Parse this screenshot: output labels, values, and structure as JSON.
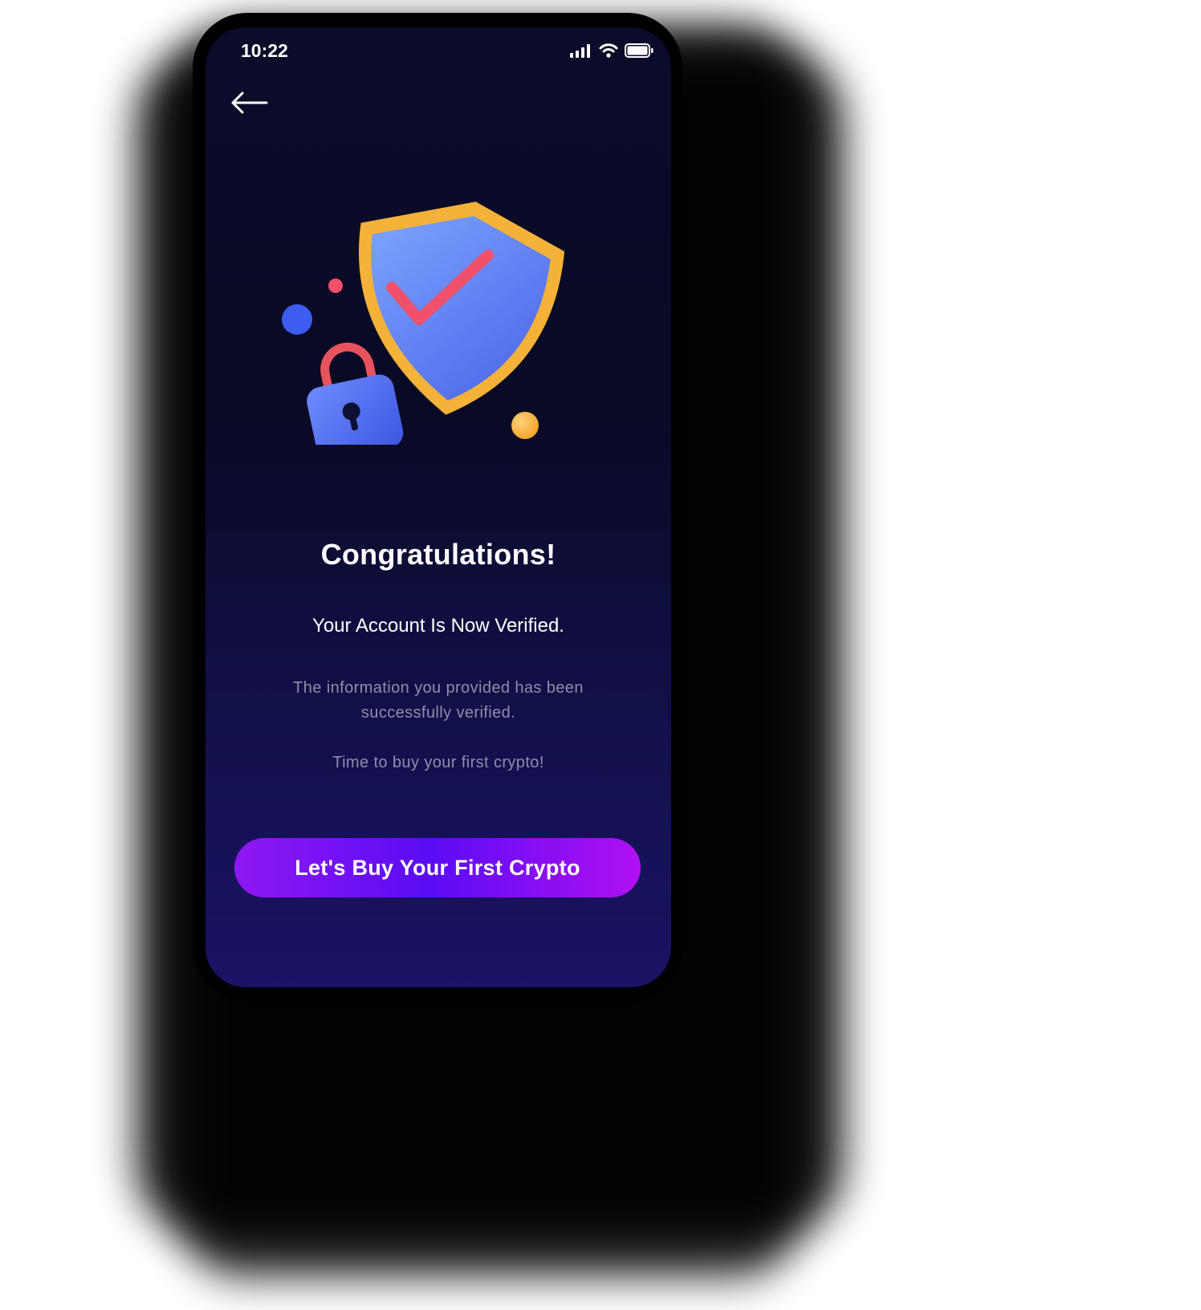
{
  "status_bar": {
    "time": "10:22",
    "icons": [
      "signal-icon",
      "wifi-icon",
      "battery-icon"
    ]
  },
  "nav": {
    "back_icon": "back-arrow-icon"
  },
  "illustration": {
    "icons": [
      "shield-check-icon",
      "padlock-icon"
    ],
    "colors": {
      "shield": "#6a8cf7",
      "shield_rim": "#f6b940",
      "check": "#f0506a",
      "lock": "#4f6ef0"
    }
  },
  "content": {
    "title": "Congratulations!",
    "subtitle": "Your Account Is Now Verified.",
    "description": "The information you provided has been successfully verified.",
    "note": "Time to buy your first crypto!"
  },
  "cta": {
    "label": "Let's Buy Your First Crypto"
  },
  "colors": {
    "background_top": "#0a0c2a",
    "background_bottom": "#1a1366",
    "button_gradient_start": "#8f18f2",
    "button_gradient_mid": "#5a0cf5",
    "button_gradient_end": "#b010f2",
    "muted_text": "#8e8ea8"
  }
}
